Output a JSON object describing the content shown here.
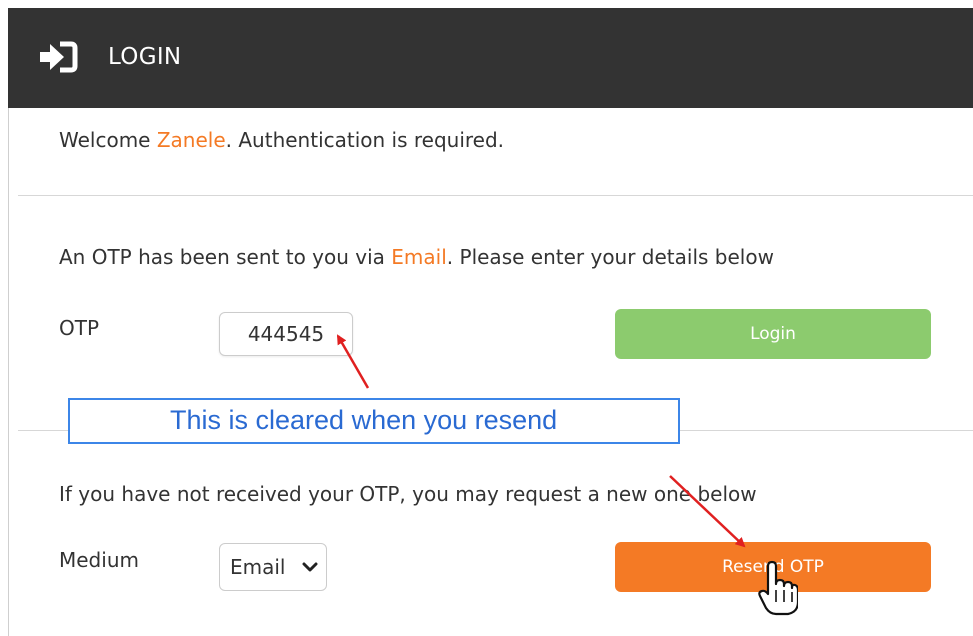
{
  "header": {
    "title": "LOGIN",
    "icon": "login-icon"
  },
  "welcome": {
    "prefix": "Welcome ",
    "name": "Zanele",
    "suffix": ". Authentication is required."
  },
  "otp_notice": {
    "prefix": "An OTP has been sent to you via ",
    "channel": "Email",
    "suffix": ". Please enter your details below"
  },
  "otp_label": "OTP",
  "otp_value": "444545",
  "login_button": "Login",
  "annotation": "This is cleared when you resend",
  "resend_notice": "If you have not received your OTP, you may request a new one below",
  "medium_label": "Medium",
  "medium_select": {
    "selected": "Email",
    "options": [
      "Email"
    ]
  },
  "resend_button": "Resend OTP",
  "colors": {
    "header_bg": "#333333",
    "accent": "#f47a25",
    "login_green": "#8ccb6e",
    "annotation_blue": "#3c86e8",
    "arrow_red": "#e02020"
  }
}
